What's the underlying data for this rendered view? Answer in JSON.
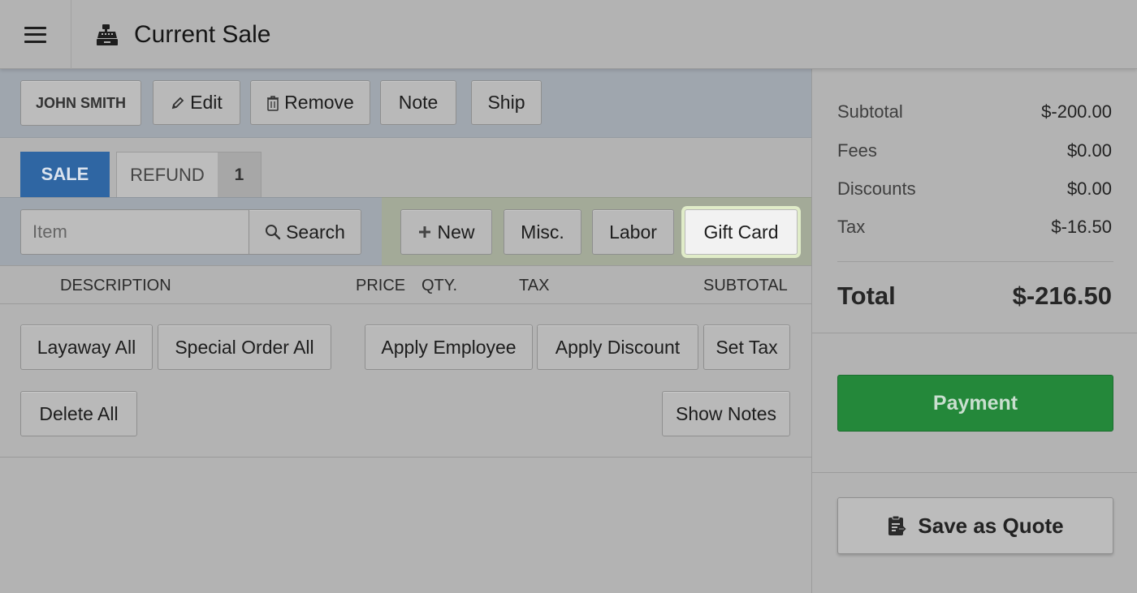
{
  "header": {
    "title": "Current Sale",
    "menu_icon": "hamburger-icon",
    "title_icon": "cash-register-icon"
  },
  "customer": {
    "name": "JOHN SMITH",
    "edit_label": "Edit",
    "remove_label": "Remove",
    "note_label": "Note",
    "ship_label": "Ship"
  },
  "tabs": {
    "sale_label": "SALE",
    "refund_label": "REFUND",
    "refund_count": "1"
  },
  "item_search": {
    "placeholder": "Item",
    "search_label": "Search"
  },
  "add_buttons": {
    "new_label": "New",
    "misc_label": "Misc.",
    "labor_label": "Labor",
    "gift_card_label": "Gift Card"
  },
  "columns": {
    "description": "DESCRIPTION",
    "price": "PRICE",
    "qty": "QTY.",
    "tax": "TAX",
    "subtotal": "SUBTOTAL"
  },
  "line_actions": {
    "layaway_all": "Layaway All",
    "special_order_all": "Special Order All",
    "apply_employee": "Apply Employee",
    "apply_discount": "Apply Discount",
    "set_tax": "Set Tax",
    "delete_all": "Delete All",
    "show_notes": "Show Notes"
  },
  "summary": {
    "subtotal_label": "Subtotal",
    "subtotal_value": "$-200.00",
    "fees_label": "Fees",
    "fees_value": "$0.00",
    "discounts_label": "Discounts",
    "discounts_value": "$0.00",
    "tax_label": "Tax",
    "tax_value": "$-16.50",
    "total_label": "Total",
    "total_value": "$-216.50"
  },
  "payment": {
    "payment_label": "Payment",
    "save_quote_label": "Save as Quote"
  },
  "colors": {
    "sale_tab": "#2f66a3",
    "payment": "#24883a",
    "customer_bar": "#9fa6ae",
    "add_zone": "#a3aa98"
  }
}
